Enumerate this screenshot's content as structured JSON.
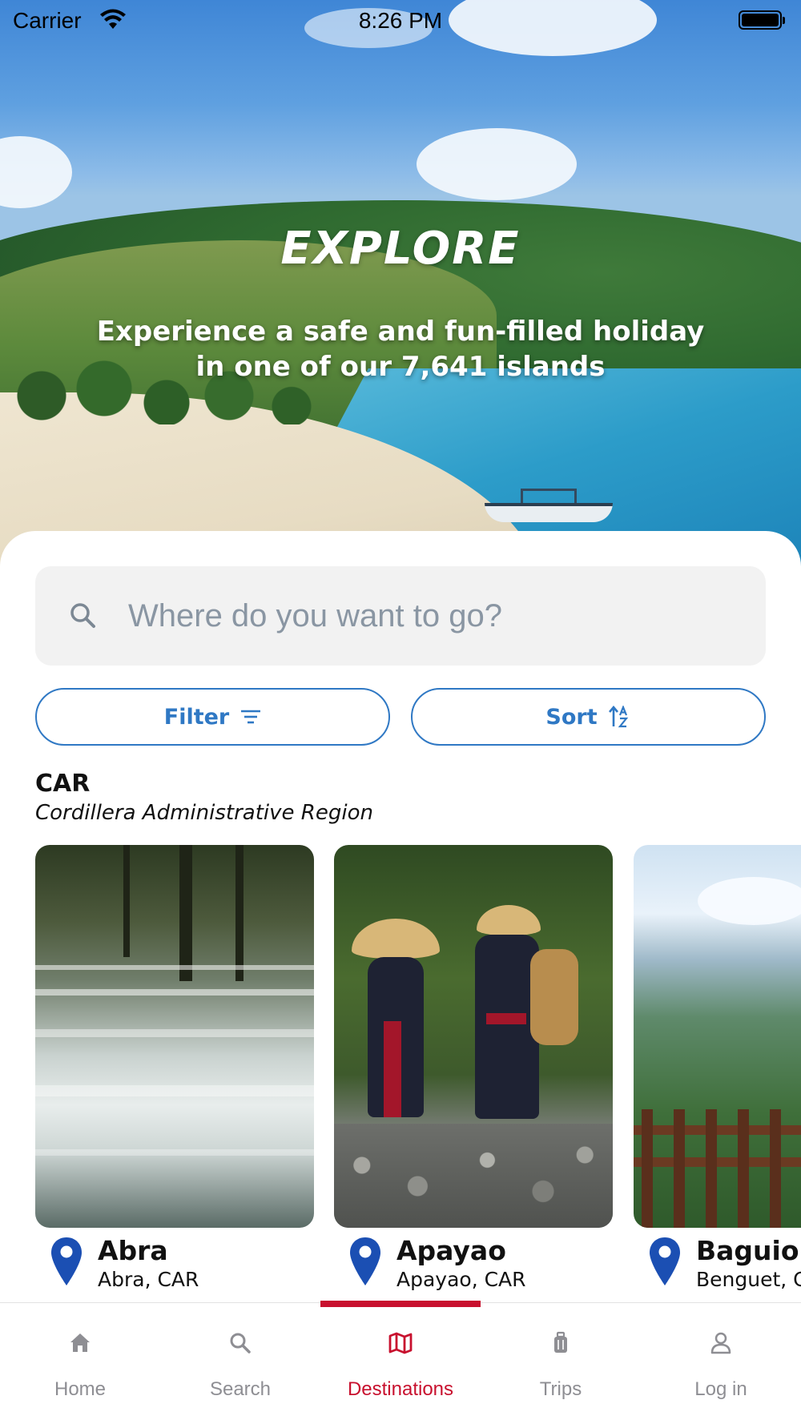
{
  "status_bar": {
    "carrier": "Carrier",
    "time": "8:26 PM",
    "icons": [
      "wifi-icon",
      "battery-icon"
    ]
  },
  "hero": {
    "title": "EXPLORE",
    "subtitle": "Experience a safe and fun-filled holiday in one of our 7,641 islands"
  },
  "search": {
    "placeholder": "Where do you want to go?",
    "value": "",
    "icon": "search-icon"
  },
  "actions": {
    "filter_label": "Filter",
    "filter_icon": "filter-lines-icon",
    "sort_label": "Sort",
    "sort_icon": "sort-az-icon"
  },
  "region": {
    "code": "CAR",
    "name": "Cordillera Administrative Region"
  },
  "destinations": [
    {
      "title": "Abra",
      "subtitle": "Abra, CAR",
      "image": "waterfall"
    },
    {
      "title": "Apayao",
      "subtitle": "Apayao, CAR",
      "image": "people-in-traditional-dress"
    },
    {
      "title": "Baguio",
      "subtitle": "Benguet, CAR",
      "image": "mountain-view"
    }
  ],
  "tabs": [
    {
      "label": "Home",
      "icon": "home-icon",
      "active": false
    },
    {
      "label": "Search",
      "icon": "search-icon",
      "active": false
    },
    {
      "label": "Destinations",
      "icon": "map-icon",
      "active": true
    },
    {
      "label": "Trips",
      "icon": "luggage-icon",
      "active": false
    },
    {
      "label": "Log in",
      "icon": "user-icon",
      "active": false
    }
  ],
  "colors": {
    "accent_red": "#c8102e",
    "pill_blue": "#2f78c4",
    "pin_blue": "#1b4fb3",
    "tab_inactive": "#8e8e93"
  }
}
